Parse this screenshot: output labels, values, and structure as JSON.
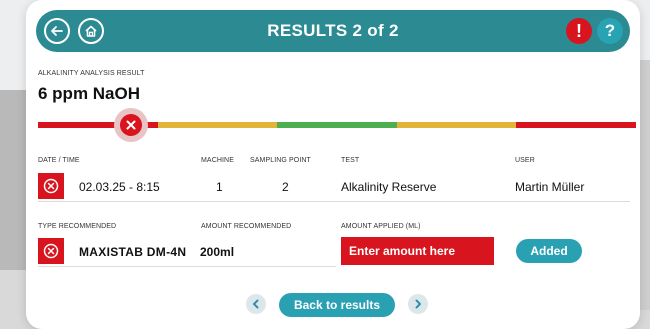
{
  "header": {
    "title": "RESULTS 2 of 2",
    "back_icon": "arrow-left-icon",
    "home_icon": "home-icon",
    "alert_icon": "exclamation-icon",
    "help_icon": "question-icon",
    "alert_symbol": "!",
    "help_symbol": "?"
  },
  "result": {
    "label": "ALKALINITY ANALYSIS RESULT",
    "value": "6 ppm NaOH",
    "gauge_colors": [
      "#d8141f",
      "#e2b53a",
      "#4caf50",
      "#e2b53a",
      "#d8141f"
    ],
    "marker_icon": "close-icon"
  },
  "measurement": {
    "headers": {
      "datetime": "DATE / TIME",
      "machine": "MACHINE",
      "sampling_point": "SAMPLING POINT",
      "test": "TEST",
      "user": "USER"
    },
    "row": {
      "icon": "remove-icon",
      "datetime": "02.03.25 - 8:15",
      "machine": "1",
      "sampling_point": "2",
      "test": "Alkalinity Reserve",
      "user": "Martin Müller"
    }
  },
  "recommendation": {
    "headers": {
      "type": "TYPE RECOMMENDED",
      "amount": "AMOUNT RECOMMENDED",
      "applied": "AMOUNT APPLIED (ML)"
    },
    "row": {
      "icon": "remove-icon",
      "product": "MAXISTAB DM-4N",
      "amount": "200ml",
      "applied_placeholder": "Enter amount here",
      "added_label": "Added"
    }
  },
  "footer": {
    "back_label": "Back to results",
    "prev_icon": "chevron-left-icon",
    "next_icon": "chevron-right-icon"
  },
  "colors": {
    "primary": "#2b8a92",
    "accent": "#2aa1b2",
    "danger": "#d8141f"
  }
}
